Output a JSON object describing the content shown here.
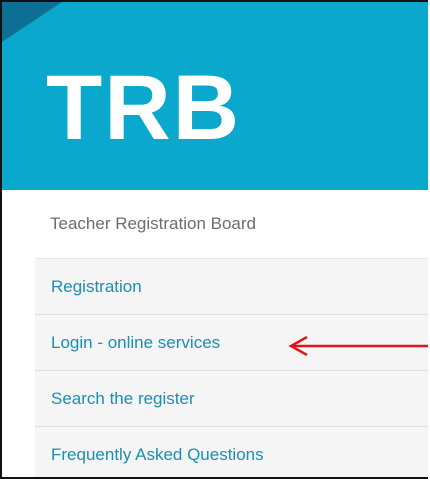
{
  "header": {
    "logo_text": "TRB",
    "colors": {
      "background": "#0aa8cc",
      "corner": "#0d6f94"
    }
  },
  "site_name": "Teacher Registration Board",
  "nav": {
    "items": [
      {
        "label": "Registration"
      },
      {
        "label": "Login - online services"
      },
      {
        "label": "Search the register"
      },
      {
        "label": "Frequently Asked Questions"
      }
    ]
  },
  "annotation": {
    "icon": "red-arrow-icon",
    "color": "#e0151b"
  }
}
